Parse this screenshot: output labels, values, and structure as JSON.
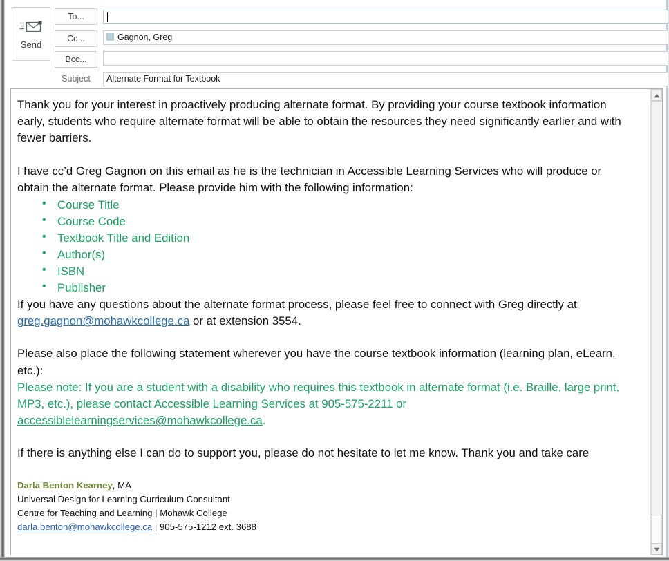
{
  "toolbar": {
    "send_label": "Send",
    "send_icon": "envelope-send-icon"
  },
  "fields": {
    "to_button": "To...",
    "cc_button": "Cc...",
    "bcc_button": "Bcc...",
    "subject_label": "Subject",
    "to_value": "",
    "cc_value": "Gagnon, Greg",
    "bcc_value": "",
    "subject_value": "Alternate Format for Textbook"
  },
  "colors": {
    "accent_green": "#1f9e63",
    "link_blue": "#2b6ca3",
    "signature_name_green": "#6f8b3a",
    "focus_border": "#a9c4d4"
  },
  "body": {
    "para1": "Thank you for your interest in proactively producing alternate format.  By providing your course textbook information early, students who require alternate format will be able to obtain the resources they need significantly earlier and with fewer barriers.",
    "para2": "I have cc’d Greg Gagnon on this email as he is the technician in Accessible Learning Services who will produce or obtain the alternate format.  Please provide him with the following information:",
    "list": [
      "Course Title",
      "Course Code",
      "Textbook Title and Edition",
      "Author(s)",
      "ISBN",
      "Publisher"
    ],
    "para3_before_link": "If you have any questions about the alternate format process, please feel free to connect with Greg directly at ",
    "para3_link": "greg.gagnon@mohawkcollege.ca",
    "para3_after_link": " or at extension 3554.",
    "para4": "Please also place the following statement wherever you have the course textbook information (learning plan, eLearn, etc.):",
    "note_before_link": "Please note: If you are a student with a disability who requires this textbook in alternate format (i.e. Braille, large print, MP3, etc.), please contact Accessible Learning Services at 905-575-2211 or ",
    "note_link": "accessiblelearningservices@mohawkcollege.ca",
    "note_after_link": ".",
    "para5": "If there is anything else I can do to support you, please do not hesitate to let me know.  Thank you and take care"
  },
  "signature": {
    "name": "Darla Benton Kearney",
    "credential": ", MA",
    "title": "Universal Design for Learning Curriculum Consultant",
    "department": "Centre for Teaching and Learning | Mohawk College",
    "email": "darla.benton@mohawkcollege.ca",
    "phone": " | 905-575-1212 ext. 3688"
  },
  "scrollbar": {
    "up_icon": "scroll-up-arrow-icon",
    "down_icon": "scroll-down-arrow-icon"
  }
}
